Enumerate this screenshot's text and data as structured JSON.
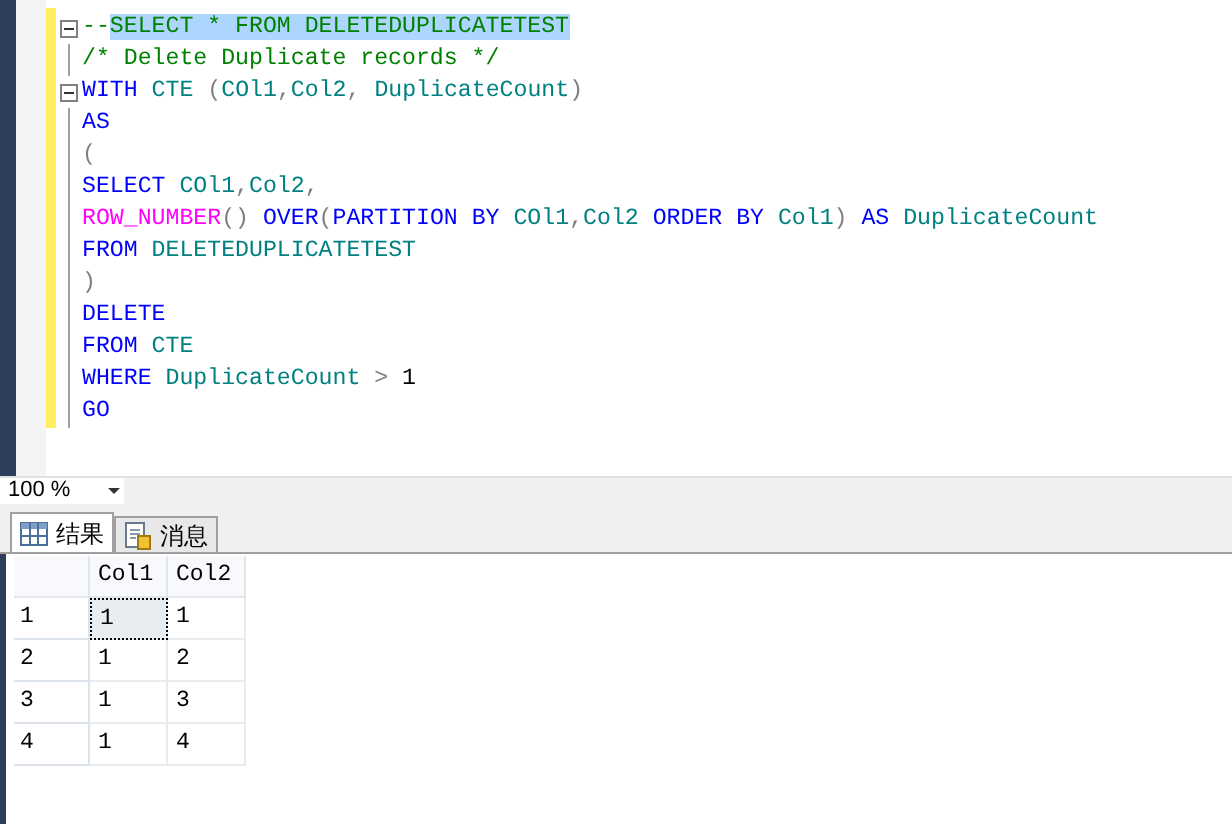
{
  "editor": {
    "lines": [
      {
        "fold": true,
        "tokens": [
          {
            "kind": "comment",
            "text": "--"
          },
          {
            "kind": "comment",
            "text": "SELECT * FROM DELETEDUPLICATETEST",
            "highlighted": true
          }
        ]
      },
      {
        "fold": false,
        "tokens": [
          {
            "kind": "comment",
            "text": "/* Delete Duplicate records */"
          }
        ]
      },
      {
        "fold": true,
        "tokens": [
          {
            "kind": "keyword",
            "text": "WITH"
          },
          {
            "kind": "identifier",
            "text": " CTE "
          },
          {
            "kind": "operator",
            "text": "("
          },
          {
            "kind": "identifier",
            "text": "COl1"
          },
          {
            "kind": "operator",
            "text": ","
          },
          {
            "kind": "identifier",
            "text": "Col2"
          },
          {
            "kind": "operator",
            "text": ", "
          },
          {
            "kind": "identifier",
            "text": "DuplicateCount"
          },
          {
            "kind": "operator",
            "text": ")"
          }
        ]
      },
      {
        "fold": false,
        "tokens": [
          {
            "kind": "keyword",
            "text": "AS"
          }
        ]
      },
      {
        "fold": false,
        "tokens": [
          {
            "kind": "operator",
            "text": "("
          }
        ]
      },
      {
        "fold": false,
        "tokens": [
          {
            "kind": "keyword",
            "text": "SELECT"
          },
          {
            "kind": "identifier",
            "text": " COl1"
          },
          {
            "kind": "operator",
            "text": ","
          },
          {
            "kind": "identifier",
            "text": "Col2"
          },
          {
            "kind": "operator",
            "text": ","
          }
        ]
      },
      {
        "fold": false,
        "tokens": [
          {
            "kind": "function",
            "text": "ROW_NUMBER"
          },
          {
            "kind": "operator",
            "text": "()"
          },
          {
            "kind": "keyword",
            "text": " OVER"
          },
          {
            "kind": "operator",
            "text": "("
          },
          {
            "kind": "keyword",
            "text": "PARTITION BY"
          },
          {
            "kind": "identifier",
            "text": " COl1"
          },
          {
            "kind": "operator",
            "text": ","
          },
          {
            "kind": "identifier",
            "text": "Col2"
          },
          {
            "kind": "keyword",
            "text": " ORDER BY"
          },
          {
            "kind": "identifier",
            "text": " Col1"
          },
          {
            "kind": "operator",
            "text": ")"
          },
          {
            "kind": "keyword",
            "text": " AS"
          },
          {
            "kind": "identifier",
            "text": " DuplicateCount"
          }
        ]
      },
      {
        "fold": false,
        "tokens": [
          {
            "kind": "keyword",
            "text": "FROM"
          },
          {
            "kind": "identifier",
            "text": " DELETEDUPLICATETEST"
          }
        ]
      },
      {
        "fold": false,
        "tokens": [
          {
            "kind": "operator",
            "text": ")"
          }
        ]
      },
      {
        "fold": false,
        "tokens": [
          {
            "kind": "keyword",
            "text": "DELETE"
          }
        ]
      },
      {
        "fold": false,
        "tokens": [
          {
            "kind": "keyword",
            "text": "FROM"
          },
          {
            "kind": "identifier",
            "text": " CTE"
          }
        ]
      },
      {
        "fold": false,
        "tokens": [
          {
            "kind": "keyword",
            "text": "WHERE"
          },
          {
            "kind": "identifier",
            "text": " DuplicateCount "
          },
          {
            "kind": "operator",
            "text": ">"
          },
          {
            "kind": "plain",
            "text": " 1"
          }
        ]
      },
      {
        "fold": false,
        "tokens": [
          {
            "kind": "keyword",
            "text": "GO"
          }
        ]
      }
    ]
  },
  "zoom": {
    "value": "100 %"
  },
  "tabs": [
    {
      "label": "结果",
      "selected": true
    },
    {
      "label": "消息",
      "selected": false
    }
  ],
  "table": {
    "columns": [
      "Col1",
      "Col2"
    ],
    "rows": [
      {
        "number": "1",
        "cells": [
          {
            "text": "1",
            "selected": true
          },
          {
            "text": "1",
            "selected": false
          }
        ]
      },
      {
        "number": "2",
        "cells": [
          {
            "text": "1",
            "selected": false
          },
          {
            "text": "2",
            "selected": false
          }
        ]
      },
      {
        "number": "3",
        "cells": [
          {
            "text": "1",
            "selected": false
          },
          {
            "text": "3",
            "selected": false
          }
        ]
      },
      {
        "number": "4",
        "cells": [
          {
            "text": "1",
            "selected": false
          },
          {
            "text": "4",
            "selected": false
          }
        ]
      }
    ]
  }
}
